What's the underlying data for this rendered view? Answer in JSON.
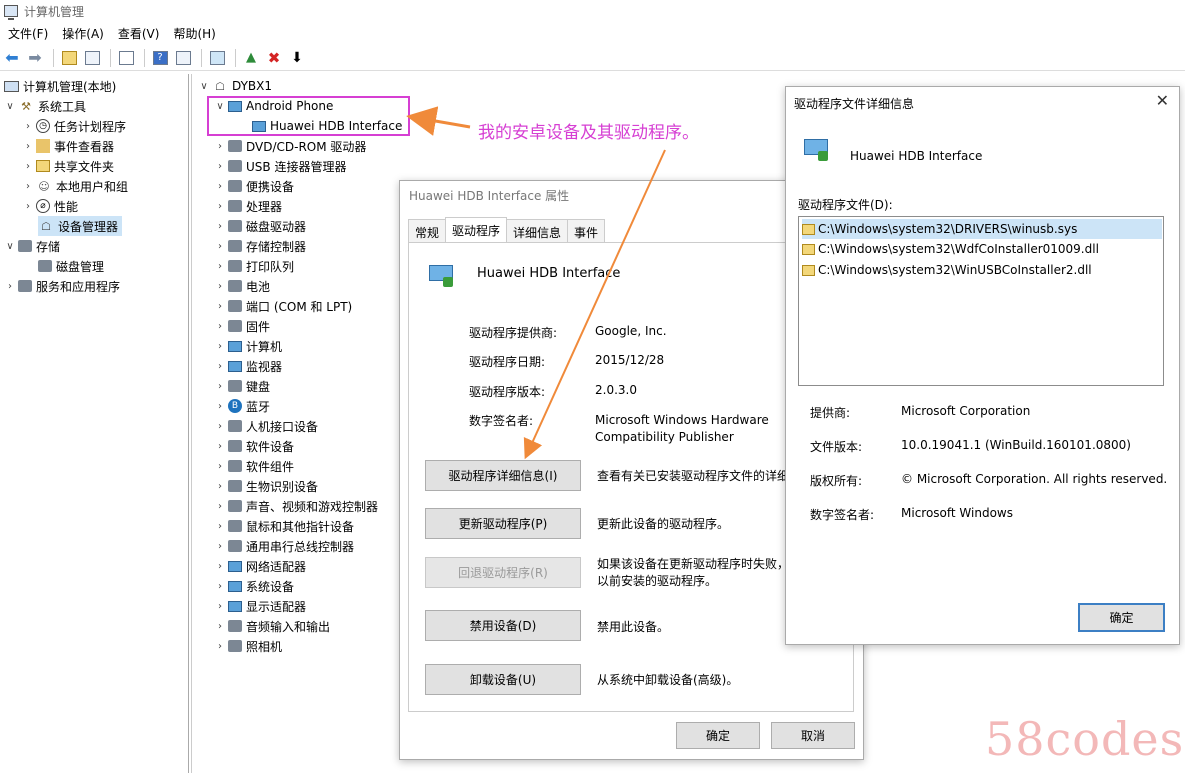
{
  "app": {
    "title": "计算机管理"
  },
  "menu": [
    "文件(F)",
    "操作(A)",
    "查看(V)",
    "帮助(H)"
  ],
  "toolbar_icons": [
    "back-arrow-icon",
    "forward-arrow-icon",
    "up-folder-icon",
    "console-tree-icon",
    "properties-icon",
    "help-icon",
    "show-hide-icon",
    "monitor-icon",
    "update-driver-icon",
    "uninstall-icon",
    "scan-icon"
  ],
  "left_tree": {
    "root": "计算机管理(本地)",
    "items": [
      "系统工具",
      "任务计划程序",
      "事件查看器",
      "共享文件夹",
      "本地用户和组",
      "性能",
      "设备管理器",
      "存储",
      "磁盘管理",
      "服务和应用程序"
    ]
  },
  "device_tree": {
    "computer": "DYBX1",
    "android_phone": "Android Phone",
    "hdb_interface": "Huawei HDB Interface",
    "categories": [
      "DVD/CD-ROM 驱动器",
      "USB 连接器管理器",
      "便携设备",
      "处理器",
      "磁盘驱动器",
      "存储控制器",
      "打印队列",
      "电池",
      "端口 (COM 和 LPT)",
      "固件",
      "计算机",
      "监视器",
      "键盘",
      "蓝牙",
      "人机接口设备",
      "软件设备",
      "软件组件",
      "生物识别设备",
      "声音、视频和游戏控制器",
      "鼠标和其他指针设备",
      "通用串行总线控制器",
      "网络适配器",
      "系统设备",
      "显示适配器",
      "音频输入和输出",
      "照相机"
    ]
  },
  "annotation": "我的安卓设备及其驱动程序。",
  "props_dialog": {
    "title": "Huawei HDB Interface 属性",
    "tabs": [
      "常规",
      "驱动程序",
      "详细信息",
      "事件"
    ],
    "device_name": "Huawei HDB Interface",
    "provider_label": "驱动程序提供商:",
    "provider_value": "Google, Inc.",
    "date_label": "驱动程序日期:",
    "date_value": "2015/12/28",
    "version_label": "驱动程序版本:",
    "version_value": "2.0.3.0",
    "signer_label": "数字签名者:",
    "signer_value": "Microsoft Windows Hardware Compatibility Publisher",
    "btn_details": "驱动程序详细信息(I)",
    "desc_details": "查看有关已安装驱动程序文件的详细",
    "btn_update": "更新驱动程序(P)",
    "desc_update": "更新此设备的驱动程序。",
    "btn_rollback": "回退驱动程序(R)",
    "desc_rollback_1": "如果该设备在更新驱动程序时失败，",
    "desc_rollback_2": "以前安装的驱动程序。",
    "btn_disable": "禁用设备(D)",
    "desc_disable": "禁用此设备。",
    "btn_uninstall": "卸载设备(U)",
    "desc_uninstall": "从系统中卸载设备(高级)。",
    "ok": "确定",
    "cancel": "取消"
  },
  "files_dialog": {
    "title": "驱动程序文件详细信息",
    "device_name": "Huawei HDB Interface",
    "list_label": "驱动程序文件(D):",
    "files": [
      "C:\\Windows\\system32\\DRIVERS\\winusb.sys",
      "C:\\Windows\\system32\\WdfCoInstaller01009.dll",
      "C:\\Windows\\system32\\WinUSBCoInstaller2.dll"
    ],
    "provider_label": "提供商:",
    "provider_value": "Microsoft Corporation",
    "version_label": "文件版本:",
    "version_value": "10.0.19041.1 (WinBuild.160101.0800)",
    "copyright_label": "版权所有:",
    "copyright_value": "© Microsoft Corporation. All rights reserved.",
    "signer_label": "数字签名者:",
    "signer_value": "Microsoft Windows",
    "ok": "确定"
  },
  "watermark": "58codes",
  "colors": {
    "annotation": "#d63fd3",
    "arrow": "#f08a3a",
    "selection": "#cce4f7",
    "watermark": "#f3b8b8"
  }
}
